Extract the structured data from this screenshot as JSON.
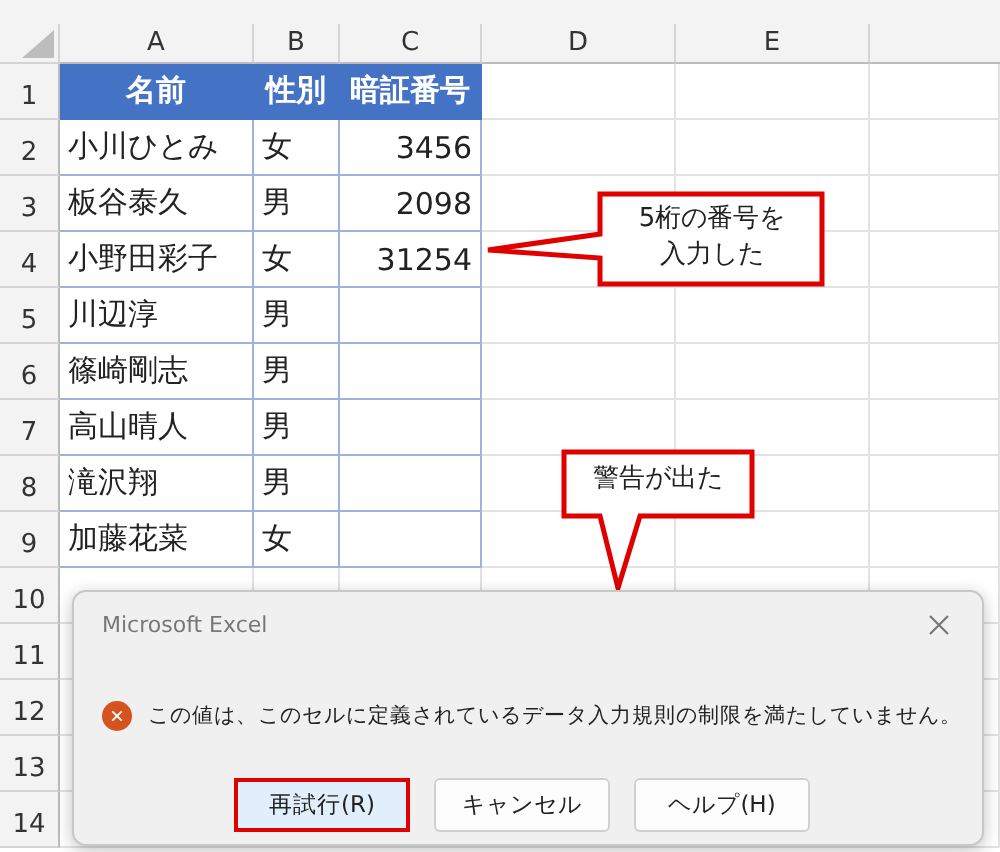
{
  "columns": [
    "A",
    "B",
    "C",
    "D",
    "E"
  ],
  "rows": [
    {
      "number": "1",
      "kind": "header",
      "cells": [
        "名前",
        "性別",
        "暗証番号"
      ]
    },
    {
      "number": "2",
      "kind": "data",
      "cells": [
        "小川ひとみ",
        "女",
        "3456"
      ]
    },
    {
      "number": "3",
      "kind": "data",
      "cells": [
        "板谷泰久",
        "男",
        "2098"
      ]
    },
    {
      "number": "4",
      "kind": "data",
      "cells": [
        "小野田彩子",
        "女",
        "31254"
      ]
    },
    {
      "number": "5",
      "kind": "data",
      "cells": [
        "川辺淳",
        "男"
      ]
    },
    {
      "number": "6",
      "kind": "data",
      "cells": [
        "篠崎剛志",
        "男"
      ]
    },
    {
      "number": "7",
      "kind": "data",
      "cells": [
        "高山晴人",
        "男"
      ]
    },
    {
      "number": "8",
      "kind": "data",
      "cells": [
        "滝沢翔",
        "男"
      ]
    },
    {
      "number": "9",
      "kind": "data",
      "cells": [
        "加藤花菜",
        "女"
      ]
    },
    {
      "number": "10",
      "kind": "empty"
    },
    {
      "number": "11",
      "kind": "empty"
    },
    {
      "number": "12",
      "kind": "empty"
    },
    {
      "number": "13",
      "kind": "empty"
    },
    {
      "number": "14",
      "kind": "empty"
    }
  ],
  "callouts": [
    {
      "kind": "left",
      "lines": [
        "5桁の番号を",
        "入力した"
      ]
    },
    {
      "kind": "down",
      "lines": [
        "警告が出た"
      ]
    }
  ],
  "dialog": {
    "title": "Microsoft Excel",
    "message": "この値は、このセルに定義されているデータ入力規則の制限を満たしていません。",
    "buttons": [
      {
        "label": "再試行(R)",
        "selected": true
      },
      {
        "label": "キャンセル",
        "selected": false
      },
      {
        "label": "ヘルプ(H)",
        "selected": false
      }
    ]
  }
}
